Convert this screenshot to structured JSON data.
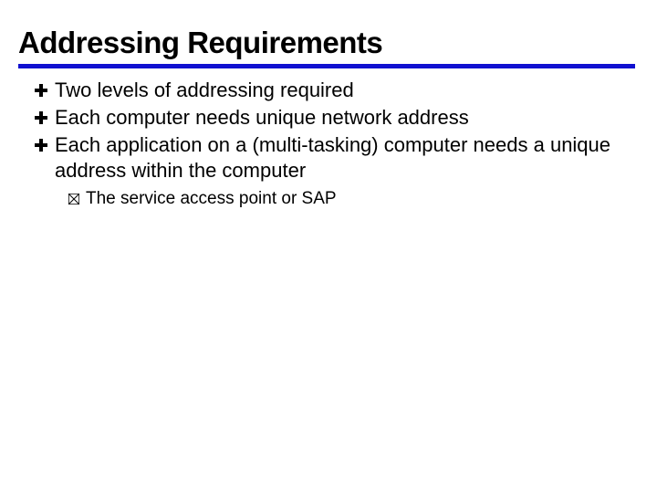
{
  "title": "Addressing Requirements",
  "bullets": [
    {
      "text": "Two levels of addressing required"
    },
    {
      "text": "Each computer needs unique network address"
    },
    {
      "text": "Each application on a (multi-tasking) computer needs a unique address within the computer"
    }
  ],
  "sub_bullets": [
    {
      "text": "The service access point or SAP"
    }
  ]
}
